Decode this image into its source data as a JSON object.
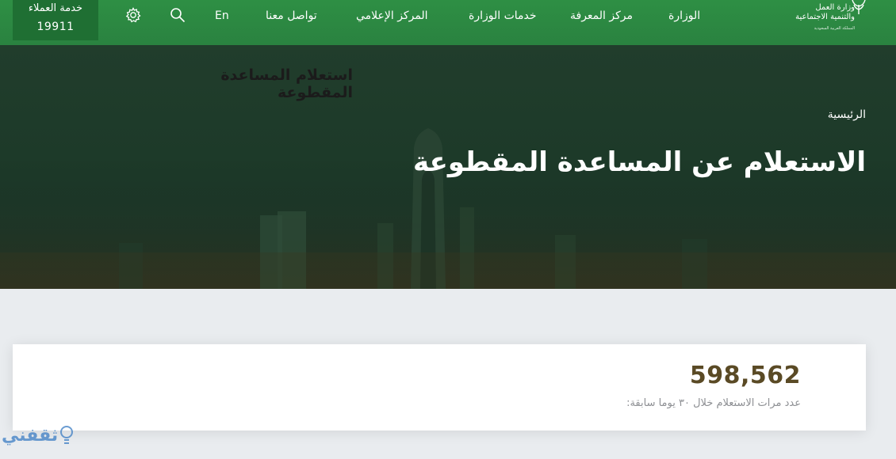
{
  "customer_service": {
    "label": "خدمة العملاء",
    "number": "19911"
  },
  "nav": {
    "language": "En",
    "items": [
      {
        "label": "الوزارة"
      },
      {
        "label": "مركز المعرفة"
      },
      {
        "label": "خدمات الوزارة"
      },
      {
        "label": "المركز الإعلامي"
      },
      {
        "label": "تواصل معنا"
      }
    ]
  },
  "logo": {
    "line1": "وزارة العمل",
    "line2": "والتنمية الاجتماعية",
    "line3": "المملكة العربية السعودية"
  },
  "hero": {
    "page_label": "استعلام المساعدة المقطوعة",
    "breadcrumb": "الرئيسية",
    "title": "الاستعلام عن المساعدة المقطوعة"
  },
  "stats": {
    "count": "598,562",
    "description": "عدد مرات الاستعلام خلال ٣٠ يوما سابقة:"
  },
  "watermark": {
    "text": "ثقفني"
  },
  "colors": {
    "brand_green": "#2b8a3e",
    "customer_service_bg": "#1f6f33",
    "count_color": "#5a4a25"
  },
  "icons": [
    "settings-icon",
    "search-icon",
    "ministry-logo-icon"
  ]
}
